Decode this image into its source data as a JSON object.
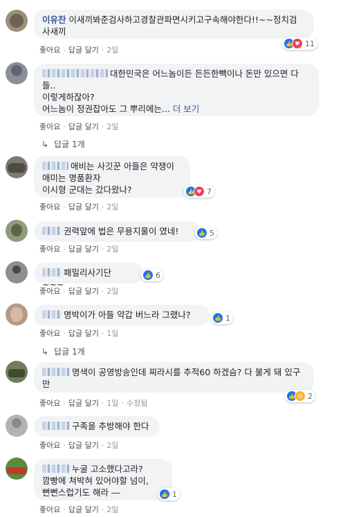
{
  "labels": {
    "like": "좋아요",
    "reply": "답글 달기",
    "see_more": "더 보기",
    "edited": "수정됨",
    "reply_count": "답글 1개"
  },
  "colors": {
    "like": "#1877f2",
    "love": "#f33e58",
    "sad": "#f7b125",
    "name": "#385898"
  },
  "comments": [
    {
      "name": "이유찬",
      "text": "이새끼봐준검사하고경찰관파면시키고구속해야한다!!~~정치검사새끼",
      "time": "2일",
      "reactions": [
        "like",
        "love"
      ],
      "count": "11"
    },
    {
      "name": "",
      "lines": [
        "대한민국은 어느놈이든 든든한빽이나 돈만 있으면 다들..",
        "이렇게하잖아?",
        "어느놈이 정권잡아도 그 뿌리에는..."
      ],
      "time": "2일",
      "reply_count": "답글 1개"
    },
    {
      "name": "",
      "lines": [
        "애비는 사깃꾼 아들은 약쟁이",
        "애미는 명품환자",
        "이시형 군대는 갔다왔나?"
      ],
      "time": "2일",
      "reactions": [
        "like",
        "love"
      ],
      "count": "7"
    },
    {
      "name": "",
      "text": "권력앞에 법은 무용지물이 였네!",
      "time": "2일",
      "reactions": [
        "like"
      ],
      "count": "5"
    },
    {
      "name": "",
      "text": "패밀리사기단 ~~~",
      "time": "2일",
      "reactions": [
        "like"
      ],
      "count": "6"
    },
    {
      "name": "",
      "text": "명박이가 아들 약갑 버느라 그랬나?",
      "time": "1일",
      "reactions": [
        "like"
      ],
      "count": "1",
      "reply_count": "답글 1개"
    },
    {
      "name": "",
      "text": "명색이 공영방송인데 찌라시를 추적60 하겠슴? 다 불게 돼 있구만",
      "time": "1일",
      "edited": "수정됨",
      "reactions": [
        "like",
        "sad"
      ],
      "count": "2"
    },
    {
      "name": "",
      "text": "구족을 추방해야 한다",
      "time": "2일"
    },
    {
      "name": "",
      "lines": [
        "누굴 고소했다고라?",
        "깜빵에 쳐박혀 있어야할 넘이,",
        "뻔뻔스럽기도 해라 ―"
      ],
      "time": "2일",
      "reactions": [
        "like"
      ],
      "count": "1"
    }
  ]
}
